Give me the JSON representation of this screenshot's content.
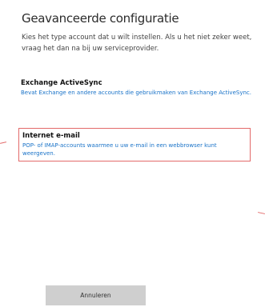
{
  "header": {
    "title": "Geavanceerde configuratie"
  },
  "intro": {
    "text": "Kies het type account dat u wilt instellen. Als u het niet zeker weet, vraag het dan na bij uw serviceprovider."
  },
  "options": [
    {
      "title": "Exchange ActiveSync",
      "description": "Bevat Exchange en andere accounts die gebruikmaken van Exchange ActiveSync."
    },
    {
      "title": "Internet e-mail",
      "description": "POP- of IMAP-accounts waarmee u uw e-mail in een webbrowser kunt weergeven."
    }
  ],
  "footer": {
    "cancel_label": "Annuleren"
  },
  "colors": {
    "link": "#1a73c8",
    "highlight_border": "#e36a6a",
    "button_bg": "#cfcfcf"
  }
}
